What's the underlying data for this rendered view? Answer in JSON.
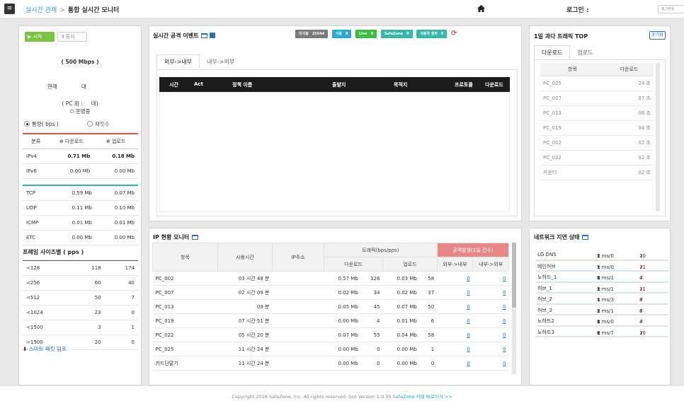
{
  "header": {
    "menu_icon": "≡",
    "breadcrumb_parent": "실시간 관제",
    "breadcrumb_sep": ">",
    "breadcrumb_current": "통합 실시간 모니터",
    "home_icon": "home-icon",
    "login_label": "로그인 :",
    "logout_label": "로그아웃"
  },
  "left": {
    "start_label": "시작",
    "stop_label": "중지",
    "bandwidth": "( 500 Mbps )",
    "current_label": "현재",
    "current_unit": "대",
    "pc_label": "( PC 외 :",
    "pc_unit": "대)",
    "status": "운영중",
    "radio_traffic": "통량( bps )",
    "radio_packets": "패킷수",
    "table_head": [
      "분류",
      "다운로드",
      "업로드"
    ],
    "ip_rows": [
      {
        "label": "IPv4",
        "down": "0.71 Mb",
        "up": "0.18 Mb"
      },
      {
        "label": "IPv6",
        "down": "0.00 Mb",
        "up": "0.00 Mb"
      }
    ],
    "proto_rows": [
      {
        "label": "TCP",
        "down": "0.59 Mb",
        "up": "0.07 Mb"
      },
      {
        "label": "UDP",
        "down": "0.11 Mb",
        "up": "0.10 Mb"
      },
      {
        "label": "ICMP",
        "down": "0.01 Mb",
        "up": "0.01 Mb"
      },
      {
        "label": "ETC",
        "down": "0.00 Mb",
        "up": "0.00 Mb"
      }
    ],
    "frame_title": "프레임 사이즈별 ( pps )",
    "frame_rows": [
      {
        "label": "<128",
        "down": "118",
        "up": "174"
      },
      {
        "label": "<256",
        "down": "60",
        "up": "40"
      },
      {
        "label": "<512",
        "down": "50",
        "up": "7"
      },
      {
        "label": "<1024",
        "down": "23",
        "up": "0"
      },
      {
        "label": "<1500",
        "down": "3",
        "up": "1"
      },
      {
        "label": ">1500",
        "down": "20",
        "up": "0"
      }
    ],
    "smart_dump": "스마트 패킷 덤프"
  },
  "attack": {
    "title": "실시간 공격 이벤트",
    "badges": [
      {
        "label": "미사용",
        "count": "25544",
        "color": "#7a7a7a"
      },
      {
        "label": "사용",
        "count": "8",
        "color": "#2aa8d8"
      },
      {
        "label": "Live",
        "count": "0",
        "color": "#3dbd3d"
      },
      {
        "label": "SafeZone",
        "count": "0",
        "color": "#35b8a8"
      },
      {
        "label": "사용자 정의",
        "count": "8",
        "color": "#35b8a8"
      }
    ],
    "refresh_icon": "refresh-icon",
    "tab_in": "외부->내부",
    "tab_out": "내부->외부",
    "columns": [
      "시간",
      "Act",
      "정책 이름",
      "출발지",
      "목적지",
      "프로토콜",
      "다운로드"
    ]
  },
  "top": {
    "title": "1일 과다 트래픽 TOP",
    "reset_label": "초기화",
    "tab_down": "다운로드",
    "tab_up": "업로드",
    "head_item": "항목",
    "head_value": "다운로드",
    "rows": [
      {
        "name": "PC_025",
        "value": "24 초"
      },
      {
        "name": "PC_007",
        "value": "07 초"
      },
      {
        "name": "PC_013",
        "value": "06 초"
      },
      {
        "name": "PC_019",
        "value": "04 초"
      },
      {
        "name": "PC_002",
        "value": "02 초"
      },
      {
        "name": "PC_022",
        "value": "02 초"
      },
      {
        "name": "카운터",
        "value": "02 초"
      }
    ]
  },
  "ip": {
    "title": "IP 현황 모니터",
    "head": {
      "item": "항목",
      "time": "사용시간",
      "ip": "IP주소",
      "traffic": "트래픽(bps/pps)",
      "attack": "공격발생(1일 건수)",
      "down": "다운로드",
      "up": "업로드",
      "in": "외부->내부",
      "out": "내부->외부"
    },
    "rows": [
      {
        "name": "PC_002",
        "time": "03 시간 48 분",
        "ip": "",
        "down": "0.57 Mb",
        "dpps": "126",
        "up": "0.03 Mb",
        "upps": "58",
        "in": "0",
        "out": "0"
      },
      {
        "name": "PC_007",
        "time": "02 시간 09 분",
        "ip": "",
        "down": "0.02 Mb",
        "dpps": "34",
        "up": "0.02 Mb",
        "upps": "37",
        "in": "0",
        "out": "0"
      },
      {
        "name": "PC_013",
        "time": "09 분",
        "ip": "",
        "down": "0.05 Mb",
        "dpps": "45",
        "up": "0.07 Mb",
        "upps": "50",
        "in": "0",
        "out": "0"
      },
      {
        "name": "PC_019",
        "time": "07 시간 51 분",
        "ip": "",
        "down": "0.00 Mb",
        "dpps": "4",
        "up": "0.01 Mb",
        "upps": "6",
        "in": "0",
        "out": "0"
      },
      {
        "name": "PC_022",
        "time": "05 시간 20 분",
        "ip": "",
        "down": "0.07 Mb",
        "dpps": "55",
        "up": "0.04 Mb",
        "upps": "58",
        "in": "0",
        "out": "0"
      },
      {
        "name": "PC_025",
        "time": "11 시간 24 분",
        "ip": "",
        "down": "0.00 Mb",
        "dpps": "0",
        "up": "0.00 Mb",
        "upps": "1",
        "in": "0",
        "out": "0"
      },
      {
        "name": "카드단말기",
        "time": "11 시간 24 분",
        "ip": "",
        "down": "0.00 Mb",
        "dpps": "0",
        "up": "0.00 Mb",
        "upps": "0",
        "in": "0",
        "out": "0"
      }
    ]
  },
  "latency": {
    "title": "네트워크 지연 상태",
    "rows": [
      {
        "name": "LG DNS",
        "time": "2 ms/0",
        "count": "10"
      },
      {
        "name": "메인허브",
        "time": "1 ms/0",
        "count": "11"
      },
      {
        "name": "노하드_1",
        "time": "0 ms/1",
        "count": "4"
      },
      {
        "name": "허브_1",
        "time": "2 ms/1",
        "count": "11"
      },
      {
        "name": "허브_2",
        "time": "1 ms/3",
        "count": "8"
      },
      {
        "name": "허브_3",
        "time": "2 ms/1",
        "count": "6"
      },
      {
        "name": "노하드2",
        "time": "0 ms/0",
        "count": "4"
      },
      {
        "name": "노하드3",
        "time": "0 ms/7",
        "count": "10"
      }
    ]
  },
  "footer": {
    "text": "Copyright 2018 SafeZone, Inc. All rights reserved. GUI Version 1.0.35",
    "link": "SafeZone 카페 바로가기 >>"
  }
}
